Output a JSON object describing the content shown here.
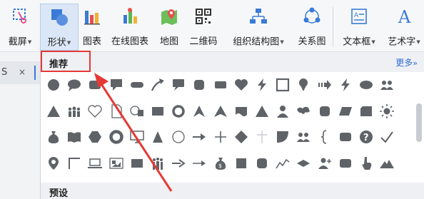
{
  "toolbar": {
    "items": [
      {
        "id": "screenshot",
        "label": "截屏",
        "dropdown": true,
        "icon": "screenshot-icon"
      },
      {
        "id": "shapes",
        "label": "形状",
        "dropdown": true,
        "icon": "shapes-icon",
        "active": true
      },
      {
        "id": "chart",
        "label": "图表",
        "dropdown": false,
        "icon": "bar-chart-icon"
      },
      {
        "id": "online-chart",
        "label": "在线图表",
        "dropdown": false,
        "icon": "online-chart-icon"
      },
      {
        "id": "map",
        "label": "地图",
        "dropdown": false,
        "icon": "map-icon"
      },
      {
        "id": "qrcode",
        "label": "二维码",
        "dropdown": false,
        "icon": "qrcode-icon"
      },
      {
        "id": "org-chart",
        "label": "组织结构图",
        "dropdown": true,
        "icon": "org-chart-icon"
      },
      {
        "id": "relation",
        "label": "关系图",
        "dropdown": false,
        "icon": "relation-diagram-icon"
      },
      {
        "id": "textbox",
        "label": "文本框",
        "dropdown": true,
        "icon": "textbox-icon"
      },
      {
        "id": "wordart",
        "label": "艺术字",
        "dropdown": true,
        "icon": "wordart-icon"
      }
    ]
  },
  "doc_tab": {
    "text": "S",
    "close": "×"
  },
  "panel": {
    "recommended_title": "推荐",
    "more_label": "更多",
    "more_chevron": "»",
    "preset_title": "预设"
  },
  "colors": {
    "accent": "#3a7bd5",
    "highlight": "#e53935",
    "shape_fill": "#5f6368",
    "active_bg": "#dbe7f7"
  },
  "shapes": [
    [
      "circle",
      "speech-bubble",
      "rounded-rect",
      "speech-rect",
      "pill",
      "curved-arrow",
      "callout-rect",
      "rounded-square",
      "rounded-rect-small",
      "heart",
      "lightning",
      "frame",
      "pin",
      "striped-arrow",
      "lightning",
      "ellipse",
      "people"
    ],
    [
      "triangle",
      "people-group",
      "heart-outline",
      "document",
      "globe-card",
      "rectangle",
      "ring",
      "arrowhead",
      "arrowhead-pointed",
      "callout-wave",
      "triangle",
      "person",
      "world-map",
      "rounded-square",
      "parallelogram",
      "rect-chamfer",
      "sun"
    ],
    [
      "money-bag",
      "book",
      "hexagon",
      "donut",
      "monitor",
      "triangle-right",
      "circle-outline",
      "long-arrow",
      "plus",
      "diamond",
      "cross-thin",
      "quarter-pie",
      "people",
      "brace",
      "rounded-rect",
      "question-circle",
      "checkmark"
    ],
    [
      "location-pin",
      "corner-bracket",
      "laptop",
      "picture-frame",
      "rectangle",
      "crowd",
      "arrow-right",
      "arrow-right-thin",
      "dollar-bag",
      "square",
      "rounded-square",
      "zigzag-line",
      "diamond-flat",
      "add-person",
      "rounded-rect",
      "hand-pointer",
      "mountain"
    ]
  ]
}
